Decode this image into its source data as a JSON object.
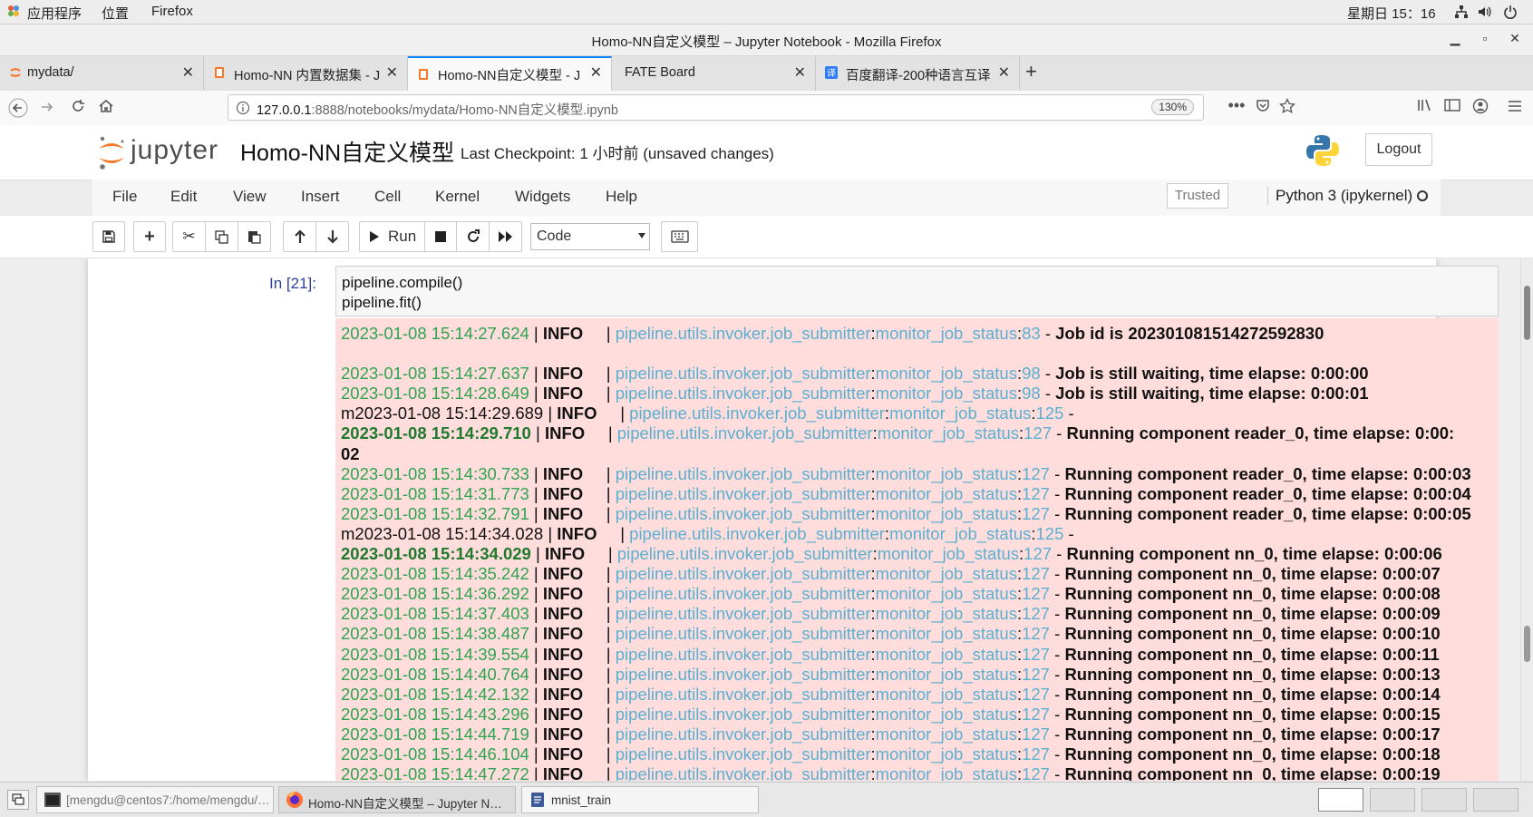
{
  "system_bar": {
    "apps_menu": "应用程序",
    "places_menu": "位置",
    "firefox_menu": "Firefox",
    "clock": "星期日 15：16"
  },
  "window": {
    "title": "Homo-NN自定义模型 – Jupyter Notebook - Mozilla Firefox"
  },
  "tabs": [
    {
      "label": "mydata/",
      "icon": "jupyter-favicon"
    },
    {
      "label": "Homo-NN 内置数据集 - J",
      "icon": "notebook-favicon"
    },
    {
      "label": "Homo-NN自定义模型 - J",
      "icon": "notebook-favicon",
      "active": true
    },
    {
      "label": "FATE Board",
      "icon": "none"
    },
    {
      "label": "百度翻译-200种语言互译",
      "icon": "baidu-translate-favicon"
    }
  ],
  "navbar": {
    "url_host": "127.0.0.1",
    "url_rest": ":8888/notebooks/mydata/Homo-NN自定义模型.ipynb",
    "zoom": "130%"
  },
  "jupyter": {
    "logo_text": "jupyter",
    "notebook_name": "Homo-NN自定义模型",
    "checkpoint": "Last Checkpoint: 1 小时前   (unsaved changes)",
    "logout": "Logout"
  },
  "menu": {
    "items": [
      "File",
      "Edit",
      "View",
      "Insert",
      "Cell",
      "Kernel",
      "Widgets",
      "Help"
    ],
    "trusted": "Trusted",
    "kernel": "Python 3 (ipykernel)"
  },
  "toolbar": {
    "run_label": "Run",
    "cell_type": "Code"
  },
  "cell": {
    "prompt": "In [21]:",
    "code": [
      "pipeline.compile()",
      "pipeline.fit()"
    ]
  },
  "log": {
    "level": "INFO",
    "module": "pipeline.utils.invoker.job_submitter",
    "func": "monitor_job_status",
    "lines": [
      {
        "ts": "2023-01-08 15:14:27.624",
        "no": "83",
        "msg": "Job id is 202301081514272592830",
        "style": "g"
      },
      {
        "ts": "2023-01-08 15:14:27.637",
        "no": "98",
        "msg": "Job is still waiting, time elapse: 0:00:00",
        "style": "g"
      },
      {
        "ts": "2023-01-08 15:14:28.649",
        "no": "98",
        "msg": "Job is still waiting, time elapse: 0:00:01",
        "style": "g"
      },
      {
        "ts": "m2023-01-08 15:14:29.689",
        "no": "125",
        "msg": "",
        "style": "m"
      },
      {
        "ts": "2023-01-08 15:14:29.710",
        "no": "127",
        "msg": "Running component reader_0, time elapse: 0:00:",
        "style": "b"
      },
      {
        "ts": "",
        "no": "",
        "msg": "02",
        "style": "cont"
      },
      {
        "ts": "2023-01-08 15:14:30.733",
        "no": "127",
        "msg": "Running component reader_0, time elapse: 0:00:03",
        "style": "g"
      },
      {
        "ts": "2023-01-08 15:14:31.773",
        "no": "127",
        "msg": "Running component reader_0, time elapse: 0:00:04",
        "style": "g"
      },
      {
        "ts": "2023-01-08 15:14:32.791",
        "no": "127",
        "msg": "Running component reader_0, time elapse: 0:00:05",
        "style": "g"
      },
      {
        "ts": "m2023-01-08 15:14:34.028",
        "no": "125",
        "msg": "",
        "style": "m"
      },
      {
        "ts": "2023-01-08 15:14:34.029",
        "no": "127",
        "msg": "Running component nn_0, time elapse: 0:00:06",
        "style": "b"
      },
      {
        "ts": "2023-01-08 15:14:35.242",
        "no": "127",
        "msg": "Running component nn_0, time elapse: 0:00:07",
        "style": "g"
      },
      {
        "ts": "2023-01-08 15:14:36.292",
        "no": "127",
        "msg": "Running component nn_0, time elapse: 0:00:08",
        "style": "g"
      },
      {
        "ts": "2023-01-08 15:14:37.403",
        "no": "127",
        "msg": "Running component nn_0, time elapse: 0:00:09",
        "style": "g"
      },
      {
        "ts": "2023-01-08 15:14:38.487",
        "no": "127",
        "msg": "Running component nn_0, time elapse: 0:00:10",
        "style": "g"
      },
      {
        "ts": "2023-01-08 15:14:39.554",
        "no": "127",
        "msg": "Running component nn_0, time elapse: 0:00:11",
        "style": "g"
      },
      {
        "ts": "2023-01-08 15:14:40.764",
        "no": "127",
        "msg": "Running component nn_0, time elapse: 0:00:13",
        "style": "g"
      },
      {
        "ts": "2023-01-08 15:14:42.132",
        "no": "127",
        "msg": "Running component nn_0, time elapse: 0:00:14",
        "style": "g"
      },
      {
        "ts": "2023-01-08 15:14:43.296",
        "no": "127",
        "msg": "Running component nn_0, time elapse: 0:00:15",
        "style": "g"
      },
      {
        "ts": "2023-01-08 15:14:44.719",
        "no": "127",
        "msg": "Running component nn_0, time elapse: 0:00:17",
        "style": "g"
      },
      {
        "ts": "2023-01-08 15:14:46.104",
        "no": "127",
        "msg": "Running component nn_0, time elapse: 0:00:18",
        "style": "g"
      },
      {
        "ts": "2023-01-08 15:14:47.272",
        "no": "127",
        "msg": "Running component nn_0, time elapse: 0:00:19",
        "style": "g"
      }
    ]
  },
  "taskbar": {
    "items": [
      {
        "label": "[mengdu@centos7:/home/mengdu/…",
        "icon": "terminal-icon"
      },
      {
        "label": "Homo-NN自定义模型 – Jupyter N…",
        "icon": "firefox-icon",
        "active": true
      },
      {
        "label": "mnist_train",
        "icon": "text-editor-icon"
      }
    ]
  },
  "colors": {
    "output_bg": "#ffdddd",
    "timestamp_green": "#2ea44f",
    "module_blue": "#5ab0d0",
    "prompt_blue": "#303f9f",
    "active_tab_accent": "#0a84ff"
  }
}
